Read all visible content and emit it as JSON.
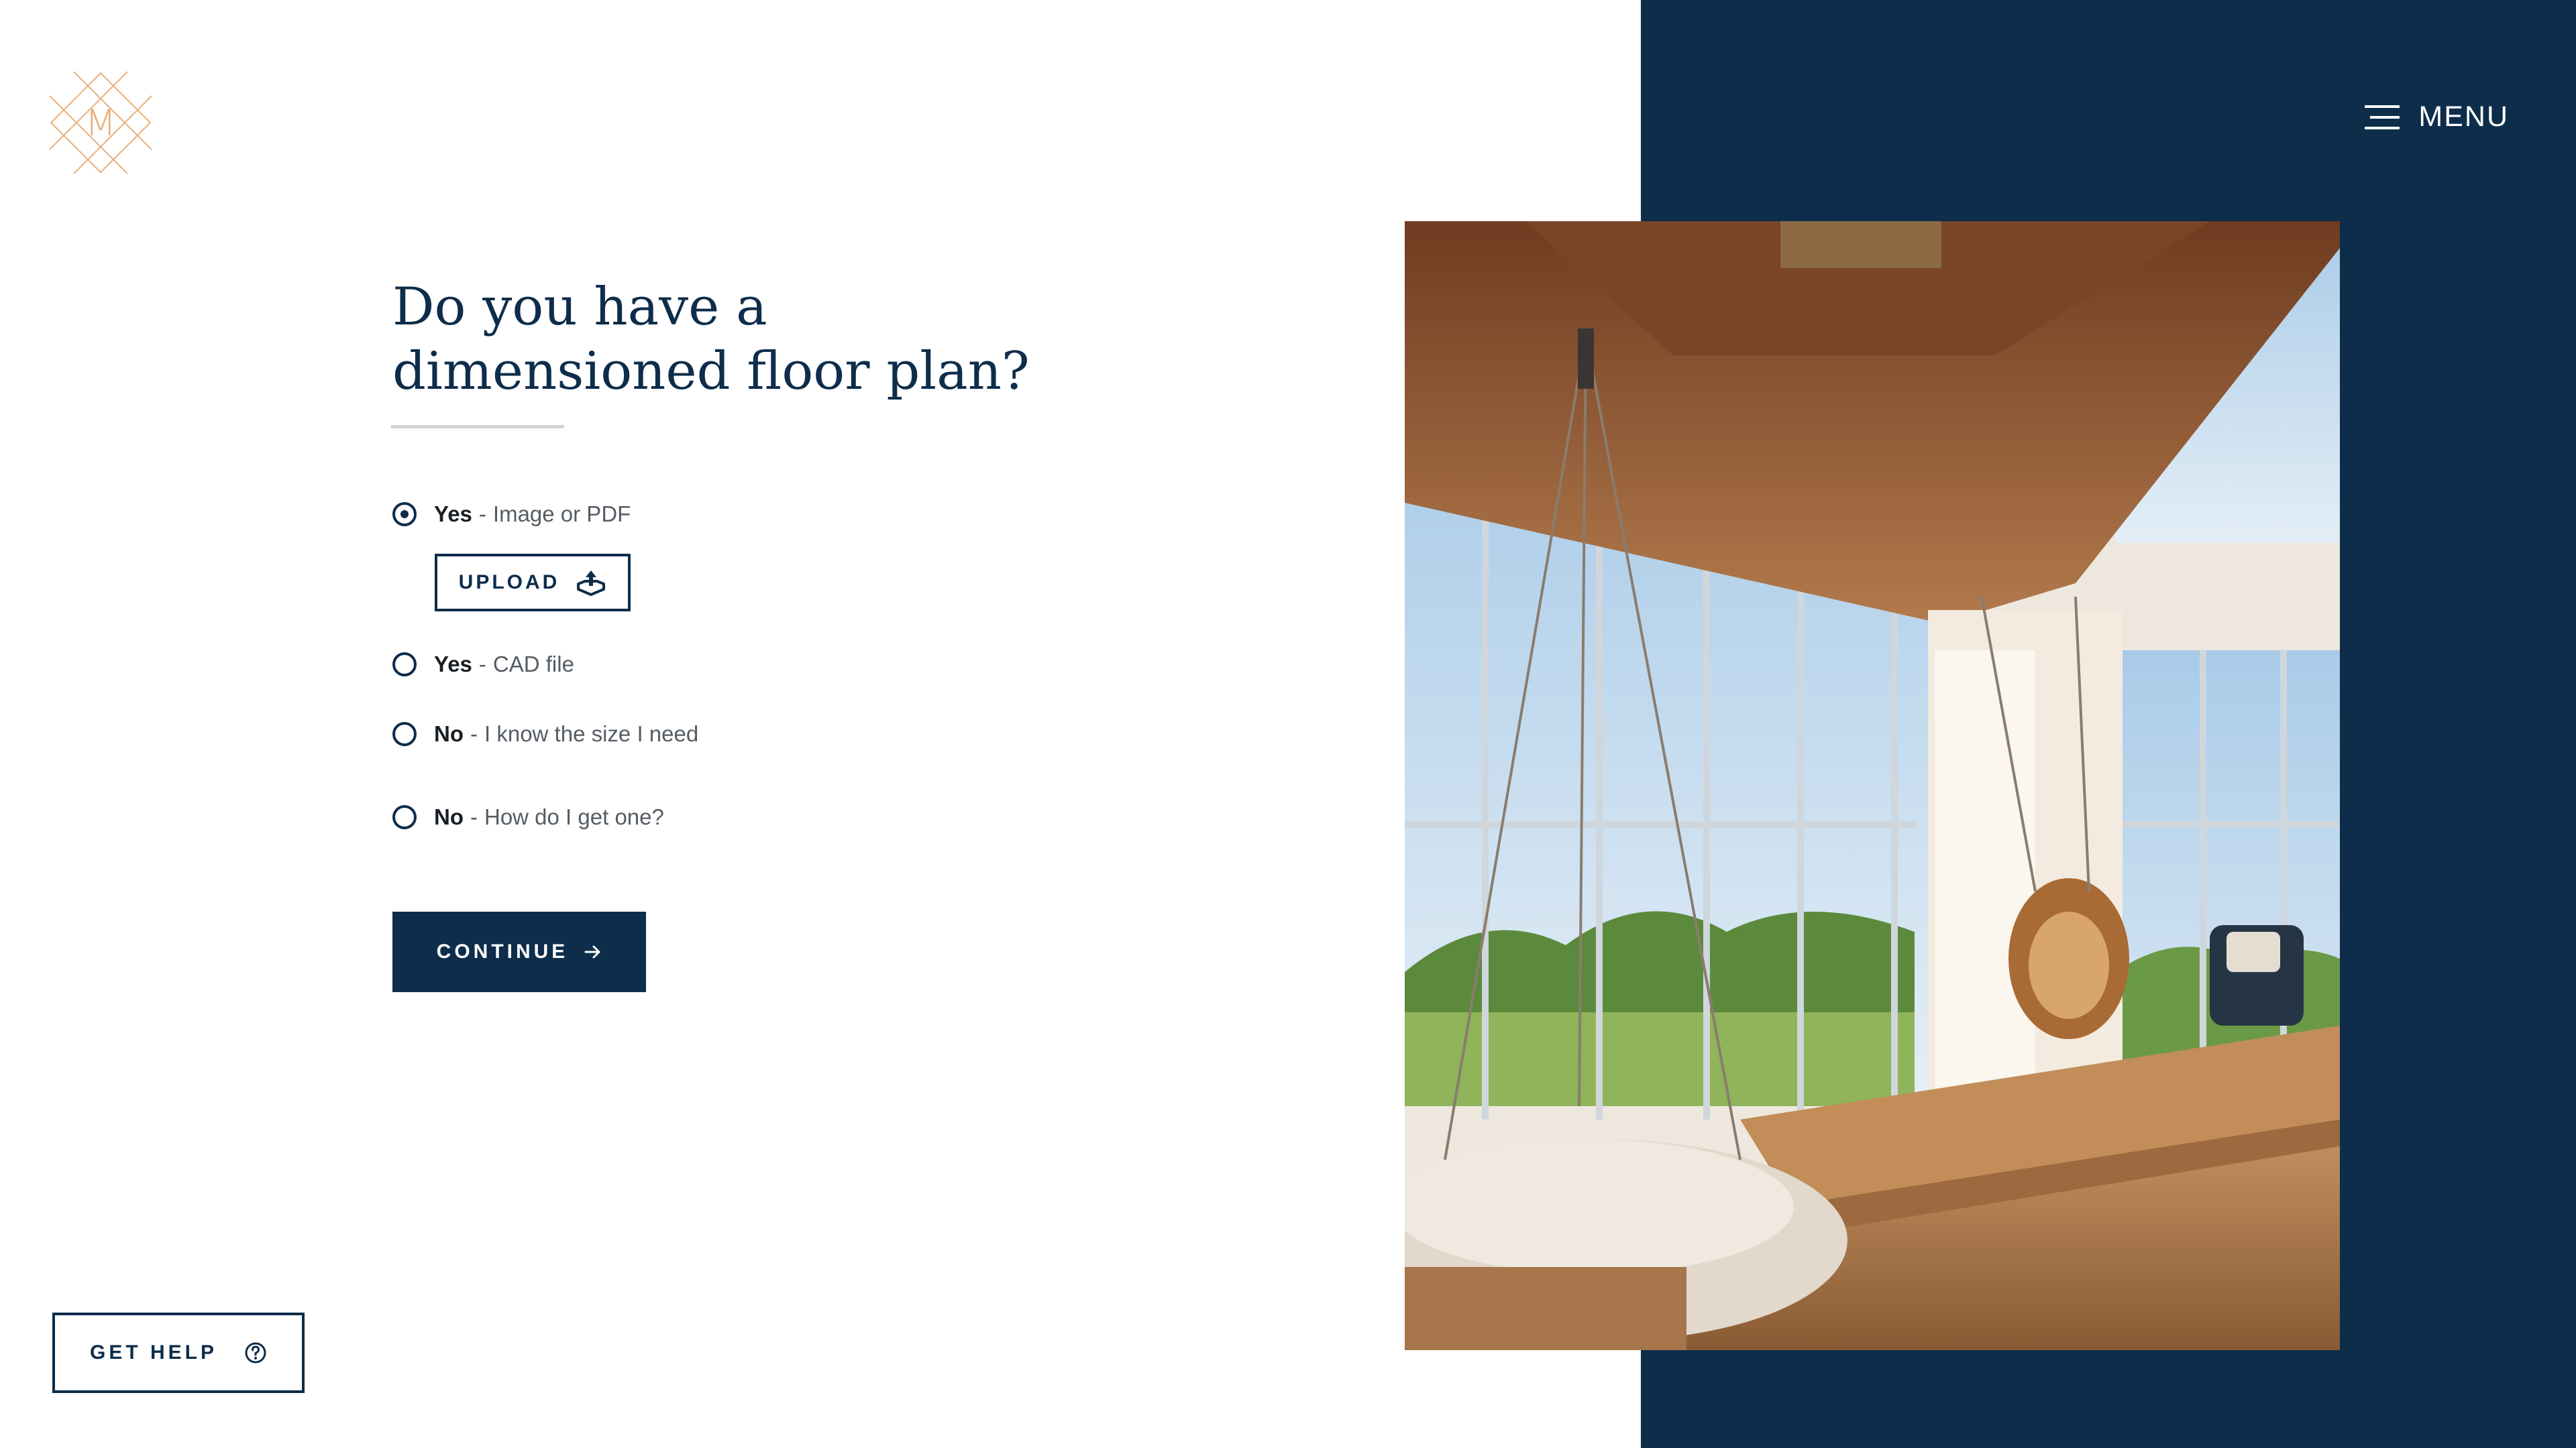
{
  "brand": {
    "logo_letter": "M",
    "logo_color": "#e8b07a"
  },
  "header": {
    "menu_label": "MENU",
    "menu_icon": "hamburger-icon"
  },
  "question": {
    "line1": "Do you have a",
    "line2": "dimensioned floor plan?"
  },
  "options": [
    {
      "strong": "Yes",
      "sep": "-",
      "detail": "Image or PDF",
      "checked": true
    },
    {
      "strong": "Yes",
      "sep": "-",
      "detail": "CAD file",
      "checked": false
    },
    {
      "strong": "No",
      "sep": "-",
      "detail": "I know the size I need",
      "checked": false
    },
    {
      "strong": "No",
      "sep": "-",
      "detail": "How do I get one?",
      "checked": false
    }
  ],
  "upload": {
    "label": "UPLOAD",
    "icon": "upload-icon"
  },
  "continue": {
    "label": "CONTINUE",
    "icon": "arrow-right-icon"
  },
  "help": {
    "label": "GET HELP",
    "icon": "question-circle-icon"
  },
  "colors": {
    "navy": "#0d2d4b",
    "accent": "#e8b07a",
    "white": "#ffffff"
  }
}
